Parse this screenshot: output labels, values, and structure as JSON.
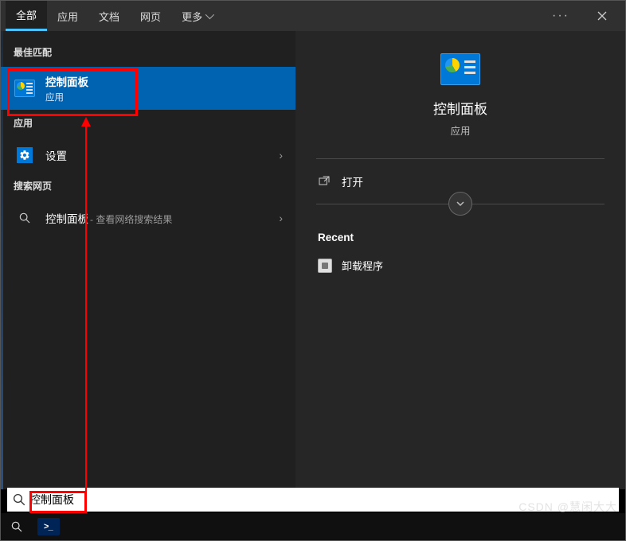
{
  "tabs": {
    "all": "全部",
    "apps": "应用",
    "docs": "文档",
    "web": "网页",
    "more": "更多"
  },
  "sections": {
    "best_match": "最佳匹配",
    "apps": "应用",
    "web": "搜索网页"
  },
  "results": {
    "best": {
      "title": "控制面板",
      "sub": "应用"
    },
    "settings": {
      "title": "设置"
    },
    "web": {
      "title": "控制面板",
      "sub": "- 查看网络搜索结果"
    }
  },
  "preview": {
    "title": "控制面板",
    "sub": "应用",
    "open": "打开",
    "recent_header": "Recent",
    "recent_item": "卸载程序"
  },
  "search": {
    "value": "控制面板"
  },
  "watermark": "CSDN @慧闲大大"
}
